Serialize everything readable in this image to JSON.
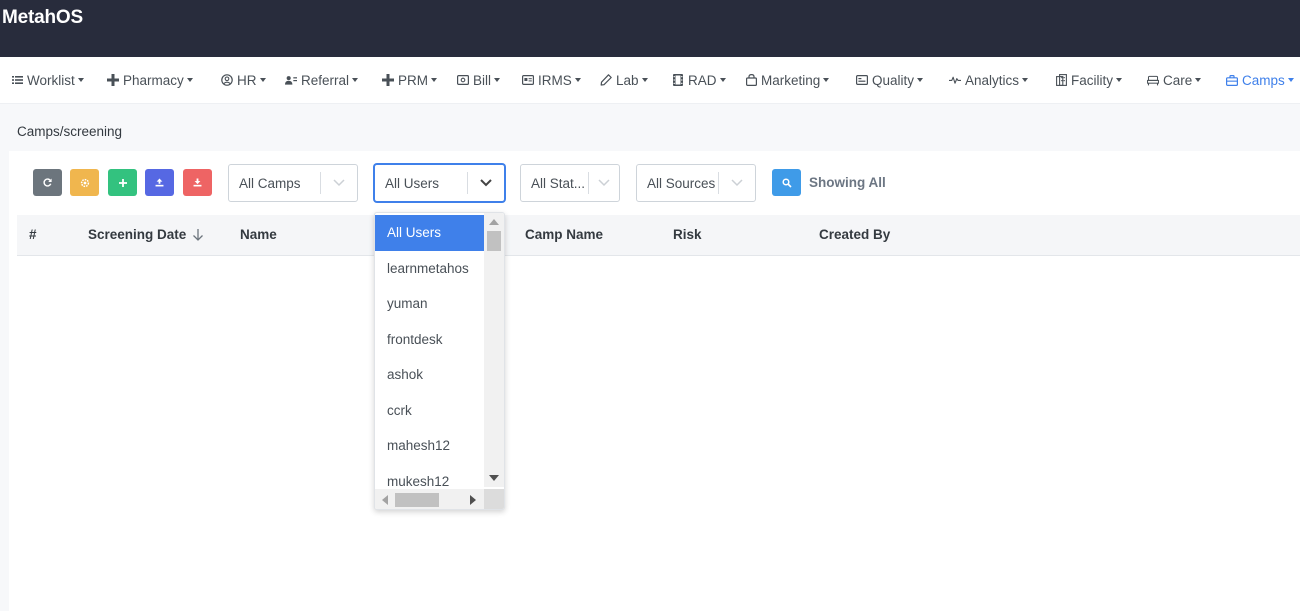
{
  "app": {
    "brand": "MetahOS"
  },
  "nav": {
    "items": [
      {
        "label": "Worklist",
        "icon": "list-icon"
      },
      {
        "label": "Pharmacy",
        "icon": "plus-icon"
      },
      {
        "label": "HR",
        "icon": "user-circle-icon"
      },
      {
        "label": "Referral",
        "icon": "users-icon"
      },
      {
        "label": "PRM",
        "icon": "plus-icon"
      },
      {
        "label": "Bill",
        "icon": "bill-icon"
      },
      {
        "label": "IRMS",
        "icon": "id-card-icon"
      },
      {
        "label": "Lab",
        "icon": "pipette-icon"
      },
      {
        "label": "RAD",
        "icon": "film-icon"
      },
      {
        "label": "Marketing",
        "icon": "bag-icon"
      },
      {
        "label": "Quality",
        "icon": "quality-icon"
      },
      {
        "label": "Analytics",
        "icon": "pulse-icon"
      },
      {
        "label": "Facility",
        "icon": "building-icon"
      },
      {
        "label": "Care",
        "icon": "bed-icon"
      },
      {
        "label": "Camps",
        "icon": "briefcase-icon",
        "active": true
      }
    ],
    "active_color": "#3f80ea"
  },
  "breadcrumb": "Camps/screening",
  "toolbar": {
    "buttons": [
      {
        "name": "refresh-button",
        "icon": "refresh-icon",
        "color": "#6c757d"
      },
      {
        "name": "settings-button",
        "icon": "gear-icon",
        "color": "#f0b64e"
      },
      {
        "name": "add-button",
        "icon": "plus-icon",
        "color": "#33c27f"
      },
      {
        "name": "upload-button",
        "icon": "upload-icon",
        "color": "#5668e3"
      },
      {
        "name": "download-button",
        "icon": "download-icon",
        "color": "#ee6464"
      }
    ],
    "filters": {
      "camps": "All Camps",
      "users": "All Users",
      "status": "All Stat...",
      "sources": "All Sources"
    },
    "showing": "Showing All"
  },
  "table": {
    "columns": [
      "#",
      "Screening Date",
      "Name",
      "Camp Name",
      "Risk",
      "Created By"
    ],
    "sort_column": "Screening Date",
    "sort_direction": "descending"
  },
  "dropdown": {
    "options": [
      "All Users",
      "learnmetahos",
      "yuman",
      "frontdesk",
      "ashok",
      "ccrk",
      "mahesh12",
      "mukesh12"
    ],
    "selected": "All Users"
  }
}
